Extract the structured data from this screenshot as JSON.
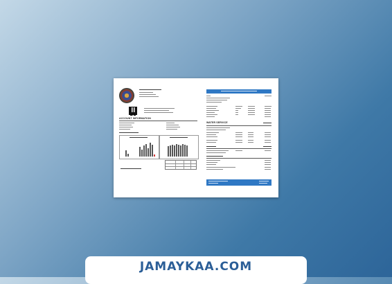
{
  "document": {
    "section_account_information": "ACCOUNT INFORMATION",
    "section_water_service": "WATER SERVICE"
  },
  "banner": {
    "text": "JAMAYKAA.COM"
  },
  "colors": {
    "brand_blue": "#2f78c4",
    "banner_text": "#2b5e97",
    "chart_alert": "#d23a3a"
  }
}
